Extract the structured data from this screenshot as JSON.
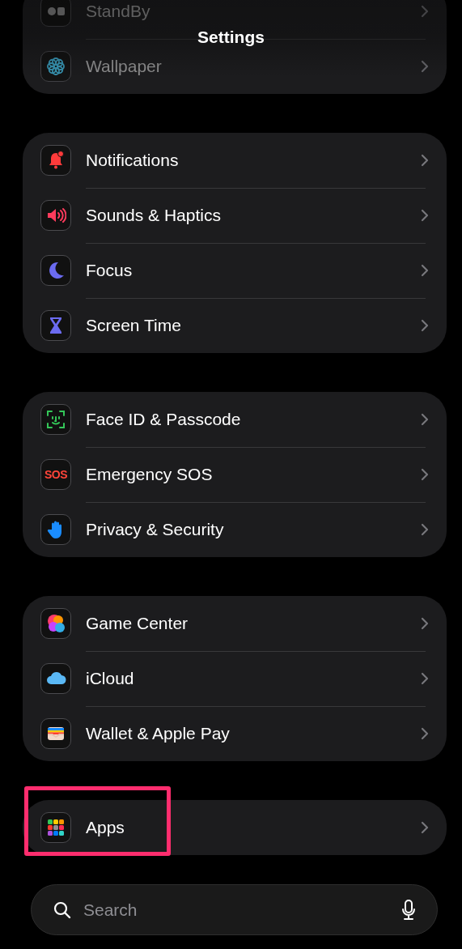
{
  "header": {
    "title": "Settings"
  },
  "groups": [
    {
      "items": [
        {
          "label": "StandBy",
          "kind": "standby",
          "dimmed": true,
          "highlighted": false
        },
        {
          "label": "Wallpaper",
          "kind": "wallpaper",
          "dimmed": true,
          "highlighted": false
        }
      ]
    },
    {
      "items": [
        {
          "label": "Notifications",
          "kind": "notifications",
          "dimmed": false,
          "highlighted": false
        },
        {
          "label": "Sounds & Haptics",
          "kind": "sounds",
          "dimmed": false,
          "highlighted": false
        },
        {
          "label": "Focus",
          "kind": "focus",
          "dimmed": false,
          "highlighted": false
        },
        {
          "label": "Screen Time",
          "kind": "screentime",
          "dimmed": false,
          "highlighted": false
        }
      ]
    },
    {
      "items": [
        {
          "label": "Face ID & Passcode",
          "kind": "faceid",
          "dimmed": false,
          "highlighted": false
        },
        {
          "label": "Emergency SOS",
          "kind": "sos",
          "icon_text": "SOS",
          "dimmed": false,
          "highlighted": false
        },
        {
          "label": "Privacy & Security",
          "kind": "privacy",
          "dimmed": false,
          "highlighted": false
        }
      ]
    },
    {
      "items": [
        {
          "label": "Game Center",
          "kind": "gamecenter",
          "dimmed": false,
          "highlighted": false
        },
        {
          "label": "iCloud",
          "kind": "icloud",
          "dimmed": false,
          "highlighted": false
        },
        {
          "label": "Wallet & Apple Pay",
          "kind": "wallet",
          "dimmed": false,
          "highlighted": false
        }
      ]
    },
    {
      "items": [
        {
          "label": "Apps",
          "kind": "apps",
          "dimmed": false,
          "highlighted": true
        }
      ]
    }
  ],
  "search": {
    "placeholder": "Search"
  }
}
